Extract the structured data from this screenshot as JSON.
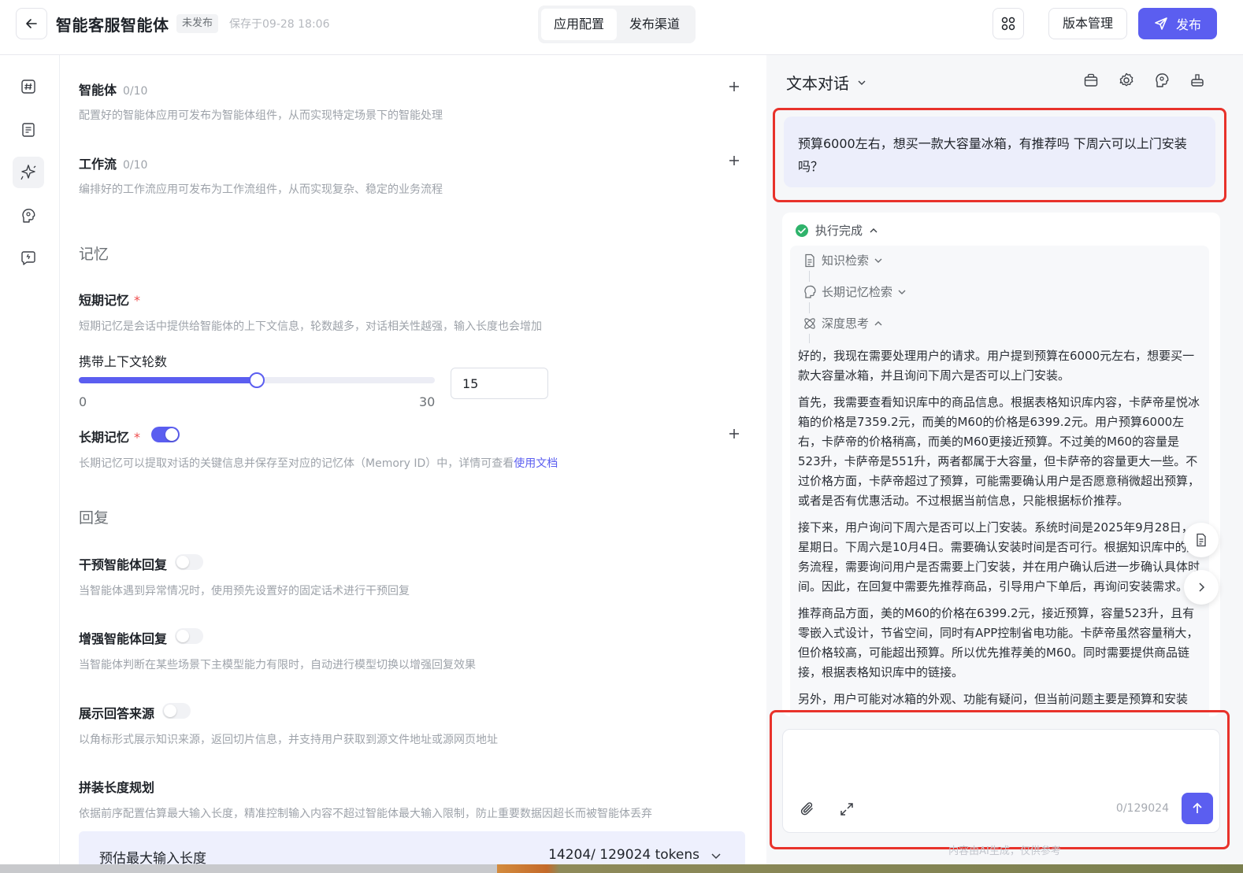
{
  "header": {
    "title": "智能客服智能体",
    "status": "未发布",
    "saved": "保存于09-28 18:06",
    "tabs": [
      {
        "label": "应用配置",
        "active": true
      },
      {
        "label": "发布渠道",
        "active": false
      }
    ],
    "version_label": "版本管理",
    "publish_label": "发布"
  },
  "rail": {
    "items": [
      "hash-icon",
      "document-list-icon",
      "sparkle-icon",
      "brain-icon",
      "chat-screen-icon"
    ],
    "active_index": 2
  },
  "config": {
    "agent": {
      "label": "智能体",
      "count": "0/10",
      "desc": "配置好的智能体应用可发布为智能体组件，从而实现特定场景下的智能处理"
    },
    "workflow": {
      "label": "工作流",
      "count": "0/10",
      "desc": "编排好的工作流应用可发布为工作流组件，从而实现复杂、稳定的业务流程"
    },
    "memory_section": "记忆",
    "short_memory": {
      "label": "短期记忆",
      "required": "*",
      "desc": "短期记忆是会话中提供给智能体的上下文信息，轮数越多，对话相关性越强，输入长度也会增加"
    },
    "context_rounds": {
      "label": "携带上下文轮数",
      "value": 15,
      "value_text": "15",
      "min": 0,
      "max": 30,
      "min_label": "0",
      "max_label": "30"
    },
    "long_memory": {
      "label": "长期记忆",
      "required": "*",
      "enabled": true,
      "desc": "长期记忆可以提取对话的关键信息并保存至对应的记忆体（Memory ID）中，详情可查看",
      "link": "使用文档"
    },
    "reply_section": "回复",
    "intervene": {
      "label": "干预智能体回复",
      "enabled": false,
      "desc": "当智能体遇到异常情况时，使用预先设置好的固定话术进行干预回复"
    },
    "enhance": {
      "label": "增强智能体回复",
      "enabled": false,
      "desc": "当智能体判断在某些场景下主模型能力有限时，自动进行模型切换以增强回复效果"
    },
    "source": {
      "label": "展示回答来源",
      "enabled": false,
      "desc": "以角标形式展示知识来源，返回切片信息，并支持用户获取到源文件地址或源网页地址"
    },
    "length_plan": {
      "label": "拼装长度规划",
      "desc": "依据前序配置估算最大输入长度，精准控制输入内容不超过智能体最大输入限制，防止重要数据因超长而被智能体丢弃"
    },
    "estimate": {
      "label": "预估最大输入长度",
      "value": "14204/ 129024 tokens"
    }
  },
  "chat": {
    "mode": "文本对话",
    "header_icons": [
      "bag-icon",
      "gear-icon",
      "brain-icon",
      "robot-icon"
    ],
    "user_message": "预算6000左右，想买一款大容量冰箱，有推荐吗 下周六可以上门安装吗？",
    "exec_status": "执行完成",
    "steps": [
      "知识检索",
      "长期记忆检索",
      "深度思考"
    ],
    "thinking": [
      "好的，我现在需要处理用户的请求。用户提到预算在6000元左右，想要买一款大容量冰箱，并且询问下周六是否可以上门安装。",
      "首先，我需要查看知识库中的商品信息。根据表格知识库内容，卡萨帝星悦冰箱的价格是7359.2元，而美的M60的价格是6399.2元。用户预算6000左右，卡萨帝的价格稍高，而美的M60更接近预算。不过美的M60的容量是523升，卡萨帝是551升，两者都属于大容量，但卡萨帝的容量更大一些。不过价格方面，卡萨帝超过了预算，可能需要确认用户是否愿意稍微超出预算，或者是否有优惠活动。不过根据当前信息，只能根据标价推荐。",
      "接下来，用户询问下周六是否可以上门安装。系统时间是2025年9月28日，星期日。下周六是10月4日。需要确认安装时间是否可行。根据知识库中的服务流程，需要询问用户是否需要上门安装，并在用户确认后进一步确认具体时间。因此，在回复中需要先推荐商品，引导用户下单后，再询问安装需求。",
      "推荐商品方面，美的M60的价格在6399.2元，接近预算，容量523升，且有零嵌入式设计，节省空间，同时有APP控制省电功能。卡萨帝虽然容量稍大，但价格较高，可能超出预算。所以优先推荐美的M60。同时需要提供商品链接，根据表格知识库中的链接。",
      "另外，用户可能对冰箱的外观、功能有疑问，但当前问题主要是预算和安装"
    ],
    "input_placeholder": "",
    "char_count": "0/129024",
    "disclaimer": "内容由AI生成，仅供参考"
  },
  "colors": {
    "accent": "#5b5ef0",
    "success": "#2fb36b",
    "highlight_border": "#e8322b"
  }
}
